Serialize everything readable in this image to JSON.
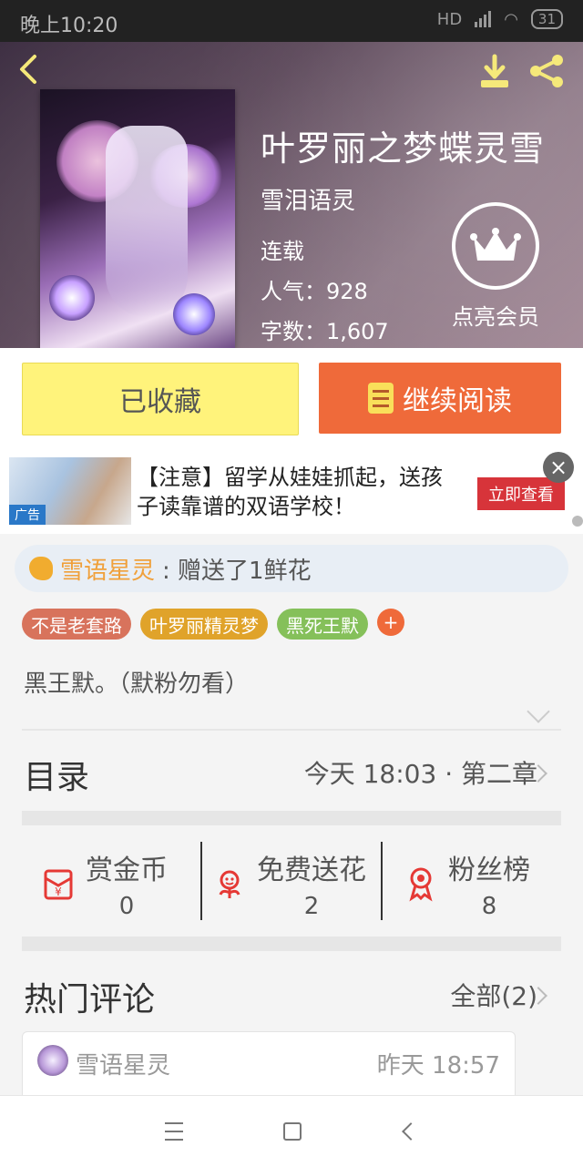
{
  "status_bar": {
    "time": "晚上10:20",
    "network_label": "HD",
    "battery": "31"
  },
  "book": {
    "title": "叶罗丽之梦蝶灵雪",
    "author": "雪泪语灵",
    "status": "连载",
    "popularity_label": "人气：928",
    "wordcount_label": "字数：1,607",
    "cover_icon": "book-cover-image"
  },
  "header": {
    "vip_label": "点亮会员",
    "icons": {
      "back": "back-icon",
      "download": "download-icon",
      "share": "share-icon",
      "vip": "crown-icon"
    }
  },
  "actions": {
    "collect_label": "已收藏",
    "read_label": "继续阅读",
    "read_icon": "book-icon"
  },
  "ad": {
    "text": "【注意】留学从娃娃抓起，送孩子读靠谱的双语学校！",
    "cta": "立即查看",
    "tag": "广告",
    "close_icon": "close-icon"
  },
  "gift": {
    "user": "雪语星灵",
    "message": ": 赠送了1鲜花",
    "icon": "hand-icon"
  },
  "tags": [
    {
      "label": "不是老套路"
    },
    {
      "label": "叶罗丽精灵梦"
    },
    {
      "label": "黑死王默"
    }
  ],
  "tag_add_label": "+",
  "intro": {
    "text": "黑王默。（默粉勿看）",
    "expand_icon": "chevron-down-icon"
  },
  "catalog": {
    "label": "目录",
    "latest": "今天 18:03 · 第二章"
  },
  "stats": [
    {
      "name": "赏金币",
      "value": "0",
      "icon": "red-envelope-icon"
    },
    {
      "name": "免费送花",
      "value": "2",
      "icon": "flower-icon"
    },
    {
      "name": "粉丝榜",
      "value": "8",
      "icon": "medal-icon"
    }
  ],
  "hot_comments": {
    "label": "热门评论",
    "all_label": "全部(2)",
    "first": {
      "user": "雪语星灵",
      "time": "昨天 18:57",
      "avatar_icon": "avatar"
    }
  },
  "navbar": {
    "menu_icon": "menu-icon",
    "home_icon": "home-icon",
    "back_icon": "back-icon"
  },
  "colors": {
    "accent_orange": "#ef6a3a",
    "collect_yellow": "#fff37b",
    "gift_user": "#f0a03a",
    "tag1": "#d8735c",
    "tag2": "#e0a32a",
    "tag3": "#85c05a",
    "icon_red": "#e53935"
  }
}
